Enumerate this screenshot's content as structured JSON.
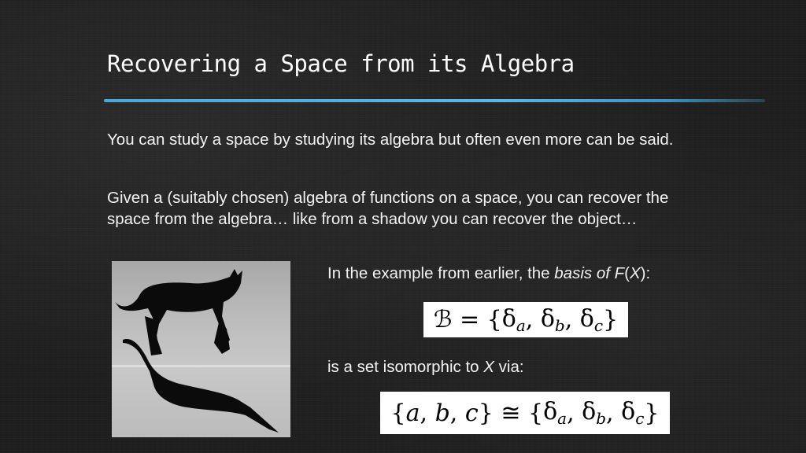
{
  "slide": {
    "title": "Recovering a Space from its Algebra",
    "paragraph1": "You can study a space by studying its algebra but often even more can be said.",
    "paragraph2": "Given a (suitably chosen) algebra of functions on a space, you can recover the space from the algebra… like from a shadow you can recover the object…",
    "caption1": {
      "prefix": "In the example from earlier, the ",
      "italic": "basis of F",
      "paren_open": "(",
      "italic2": "X",
      "suffix": "):"
    },
    "equation1": {
      "lhs": "ℬ",
      "op": " = ",
      "open": "{",
      "terms": [
        {
          "sym": "δ",
          "sub": "a"
        },
        {
          "sym": "δ",
          "sub": "b"
        },
        {
          "sym": "δ",
          "sub": "c"
        }
      ],
      "close": "}"
    },
    "caption2": {
      "prefix": "is a set isomorphic to ",
      "italic": "X",
      "suffix": " via:"
    },
    "equation2": {
      "lhs_open": "{",
      "lhs_terms": [
        "a",
        "b",
        "c"
      ],
      "lhs_close": "}",
      "op": " ≅ ",
      "rhs_open": "{",
      "rhs_terms": [
        {
          "sym": "δ",
          "sub": "a"
        },
        {
          "sym": "δ",
          "sub": "b"
        },
        {
          "sym": "δ",
          "sub": "c"
        }
      ],
      "rhs_close": "}"
    },
    "image": {
      "description": "cat-and-shadow-photo"
    },
    "colors": {
      "accent_rule": "#4aa8d8",
      "background": "#1e1e1e",
      "text": "#f2f2f2"
    }
  }
}
